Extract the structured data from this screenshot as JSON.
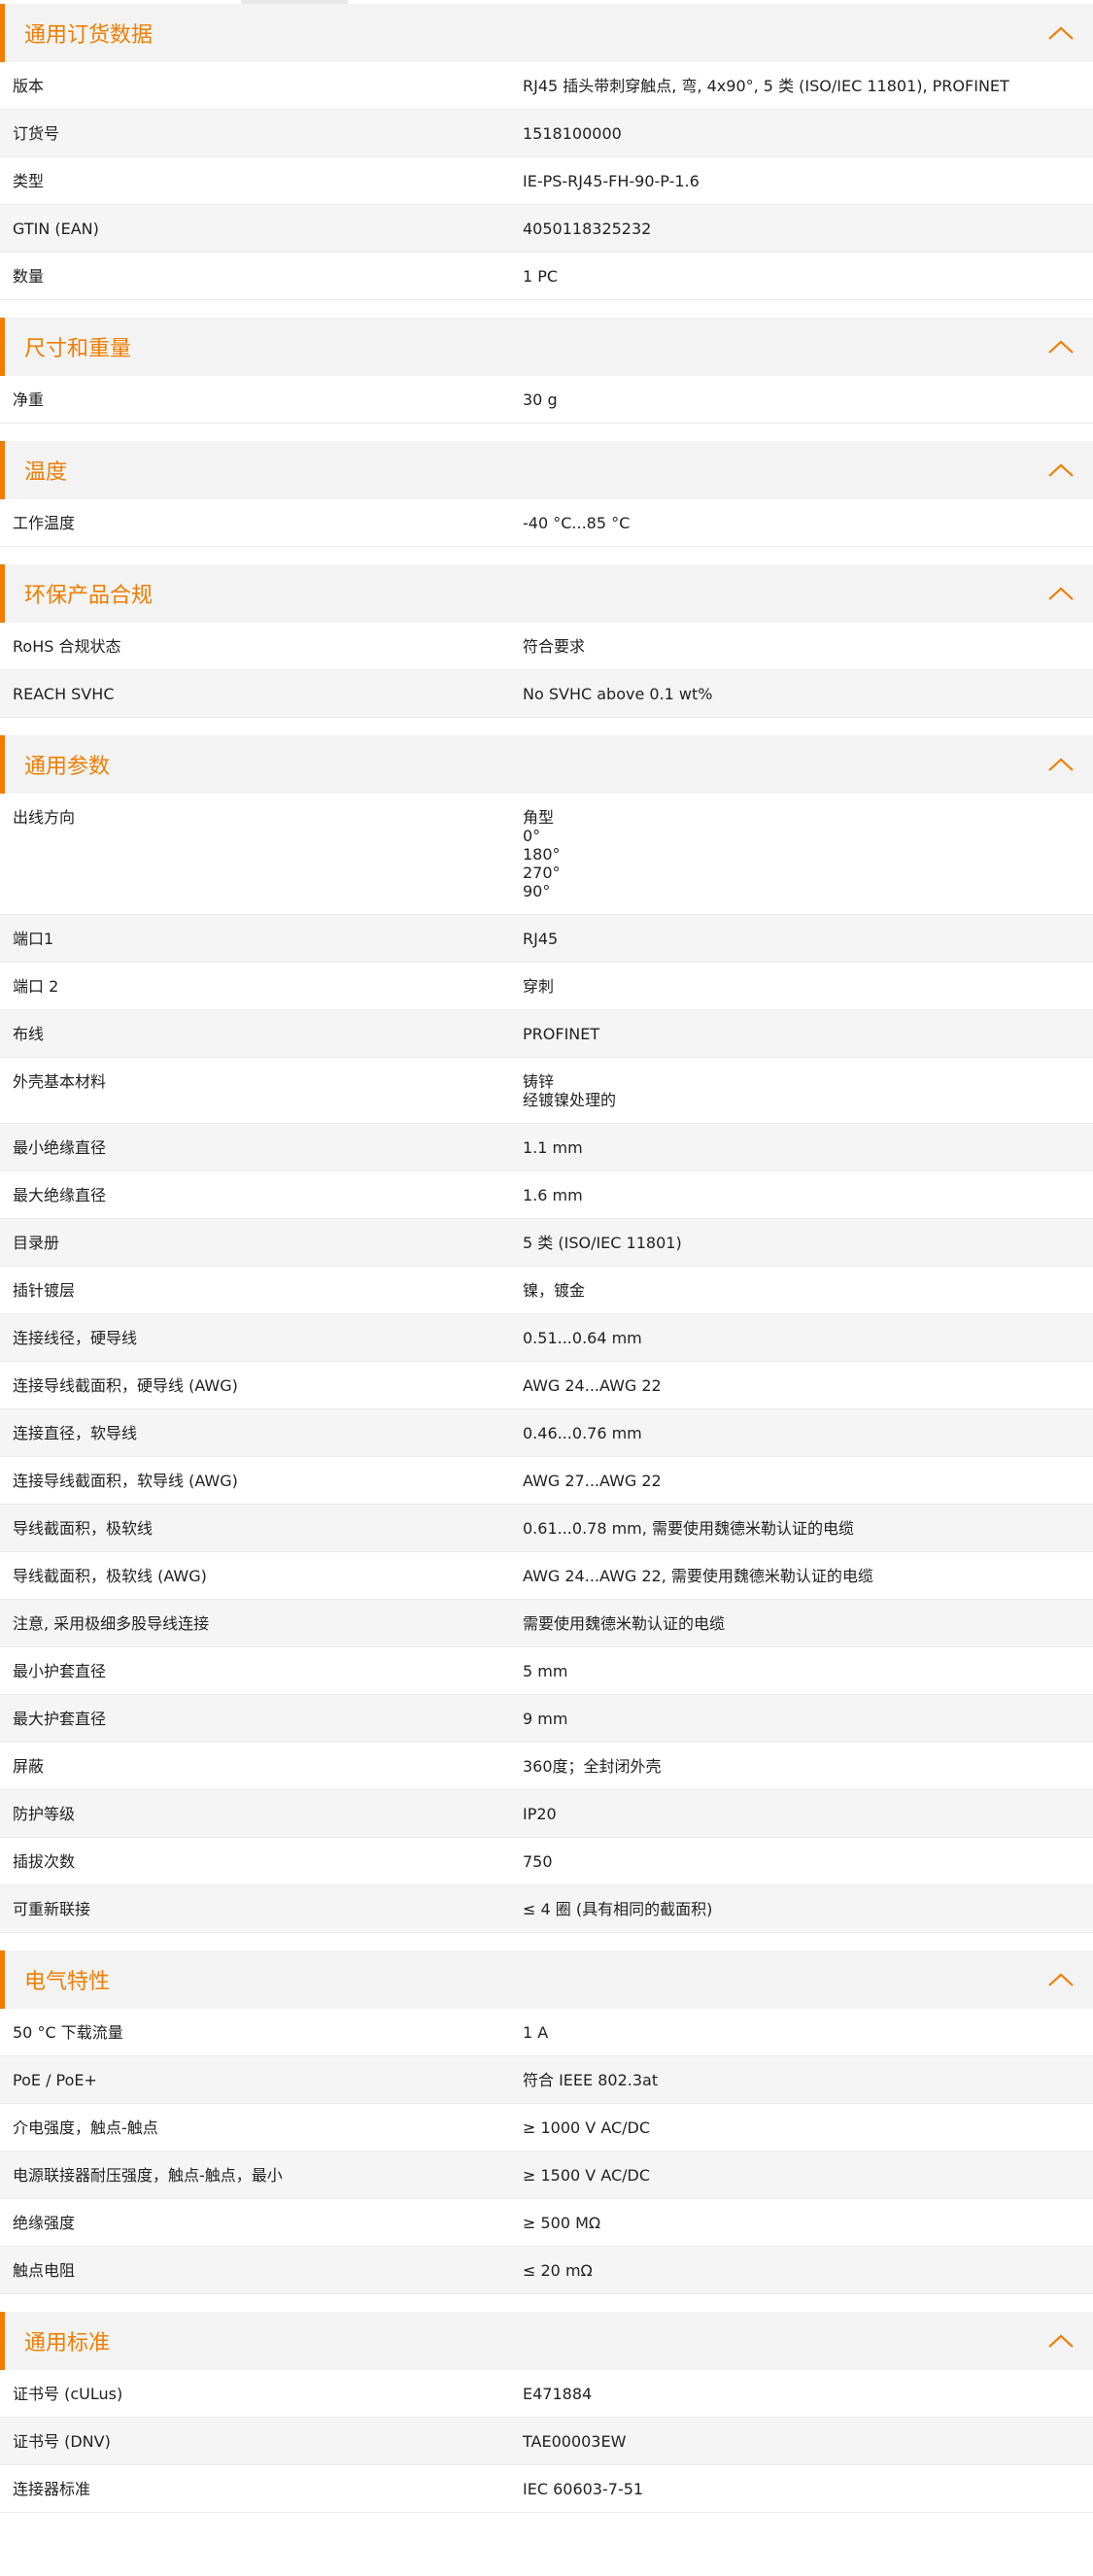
{
  "colors": {
    "accent": "#f07d00",
    "header_bg": "#f3f3f3",
    "alt_row_bg": "#f5f5f5"
  },
  "icons": {
    "collapse": "chevron-up-icon"
  },
  "sections": [
    {
      "title": "通用订货数据",
      "rows": [
        {
          "k": "版本",
          "v": [
            "RJ45 插头带刺穿触点, 弯, 4x90°, 5 类 (ISO/IEC 11801), PROFINET"
          ]
        },
        {
          "k": "订货号",
          "v": [
            "1518100000"
          ]
        },
        {
          "k": "类型",
          "v": [
            "IE-PS-RJ45-FH-90-P-1.6"
          ]
        },
        {
          "k": "GTIN (EAN)",
          "v": [
            "4050118325232"
          ]
        },
        {
          "k": "数量",
          "v": [
            "1  PC"
          ]
        }
      ]
    },
    {
      "title": "尺寸和重量",
      "rows": [
        {
          "k": "净重",
          "v": [
            "30  g"
          ]
        }
      ]
    },
    {
      "title": "温度",
      "rows": [
        {
          "k": "工作温度",
          "v": [
            "-40 °C...85 °C"
          ]
        }
      ]
    },
    {
      "title": "环保产品合规",
      "rows": [
        {
          "k": "RoHS 合规状态",
          "v": [
            "符合要求"
          ]
        },
        {
          "k": "REACH SVHC",
          "v": [
            "No SVHC above 0.1 wt%"
          ]
        }
      ]
    },
    {
      "title": "通用参数",
      "rows": [
        {
          "k": "出线方向",
          "v": [
            "角型",
            "0°",
            "180°",
            "270°",
            "90°"
          ]
        },
        {
          "k": "端口1",
          "v": [
            "RJ45"
          ]
        },
        {
          "k": "端口 2",
          "v": [
            "穿刺"
          ]
        },
        {
          "k": "布线",
          "v": [
            "PROFINET"
          ]
        },
        {
          "k": "外壳基本材料",
          "v": [
            "铸锌",
            "经镀镍处理的"
          ]
        },
        {
          "k": "最小绝缘直径",
          "v": [
            "1.1  mm"
          ]
        },
        {
          "k": "最大绝缘直径",
          "v": [
            "1.6  mm"
          ]
        },
        {
          "k": "目录册",
          "v": [
            "5 类 (ISO/IEC 11801)"
          ]
        },
        {
          "k": "插针镀层",
          "v": [
            "镍，镀金"
          ]
        },
        {
          "k": "连接线径，硬导线",
          "v": [
            "0.51...0.64 mm"
          ]
        },
        {
          "k": "连接导线截面积，硬导线 (AWG)",
          "v": [
            "AWG 24...AWG 22"
          ]
        },
        {
          "k": "连接直径，软导线",
          "v": [
            "0.46...0.76 mm"
          ]
        },
        {
          "k": "连接导线截面积，软导线 (AWG)",
          "v": [
            "AWG 27...AWG 22"
          ]
        },
        {
          "k": "导线截面积，极软线",
          "v": [
            "0.61...0.78 mm, 需要使用魏德米勒认证的电缆"
          ]
        },
        {
          "k": "导线截面积，极软线 (AWG)",
          "v": [
            "AWG 24...AWG 22, 需要使用魏德米勒认证的电缆"
          ]
        },
        {
          "k": "注意, 采用极细多股导线连接",
          "v": [
            "需要使用魏德米勒认证的电缆"
          ]
        },
        {
          "k": "最小护套直径",
          "v": [
            "5  mm"
          ]
        },
        {
          "k": "最大护套直径",
          "v": [
            "9  mm"
          ]
        },
        {
          "k": "屏蔽",
          "v": [
            "360度；全封闭外壳"
          ]
        },
        {
          "k": "防护等级",
          "v": [
            "IP20"
          ]
        },
        {
          "k": "插拔次数",
          "v": [
            "750"
          ]
        },
        {
          "k": "可重新联接",
          "v": [
            "≤ 4 圈 (具有相同的截面积)"
          ]
        }
      ]
    },
    {
      "title": "电气特性",
      "rows": [
        {
          "k": "50 °C 下载流量",
          "v": [
            "1  A"
          ]
        },
        {
          "k": "PoE / PoE+",
          "v": [
            "符合 IEEE 802.3at"
          ]
        },
        {
          "k": "介电强度，触点-触点",
          "v": [
            "≥ 1000 V AC/DC"
          ]
        },
        {
          "k": "电源联接器耐压强度，触点-触点，最小",
          "v": [
            "≥ 1500 V AC/DC"
          ]
        },
        {
          "k": "绝缘强度",
          "v": [
            "≥ 500 MΩ"
          ]
        },
        {
          "k": "触点电阻",
          "v": [
            "≤ 20 mΩ"
          ]
        }
      ]
    },
    {
      "title": "通用标准",
      "rows": [
        {
          "k": "证书号 (cULus)",
          "v": [
            "E471884"
          ]
        },
        {
          "k": "证书号 (DNV)",
          "v": [
            "TAE00003EW"
          ]
        },
        {
          "k": "连接器标准",
          "v": [
            "IEC 60603-7-51"
          ]
        }
      ]
    }
  ]
}
